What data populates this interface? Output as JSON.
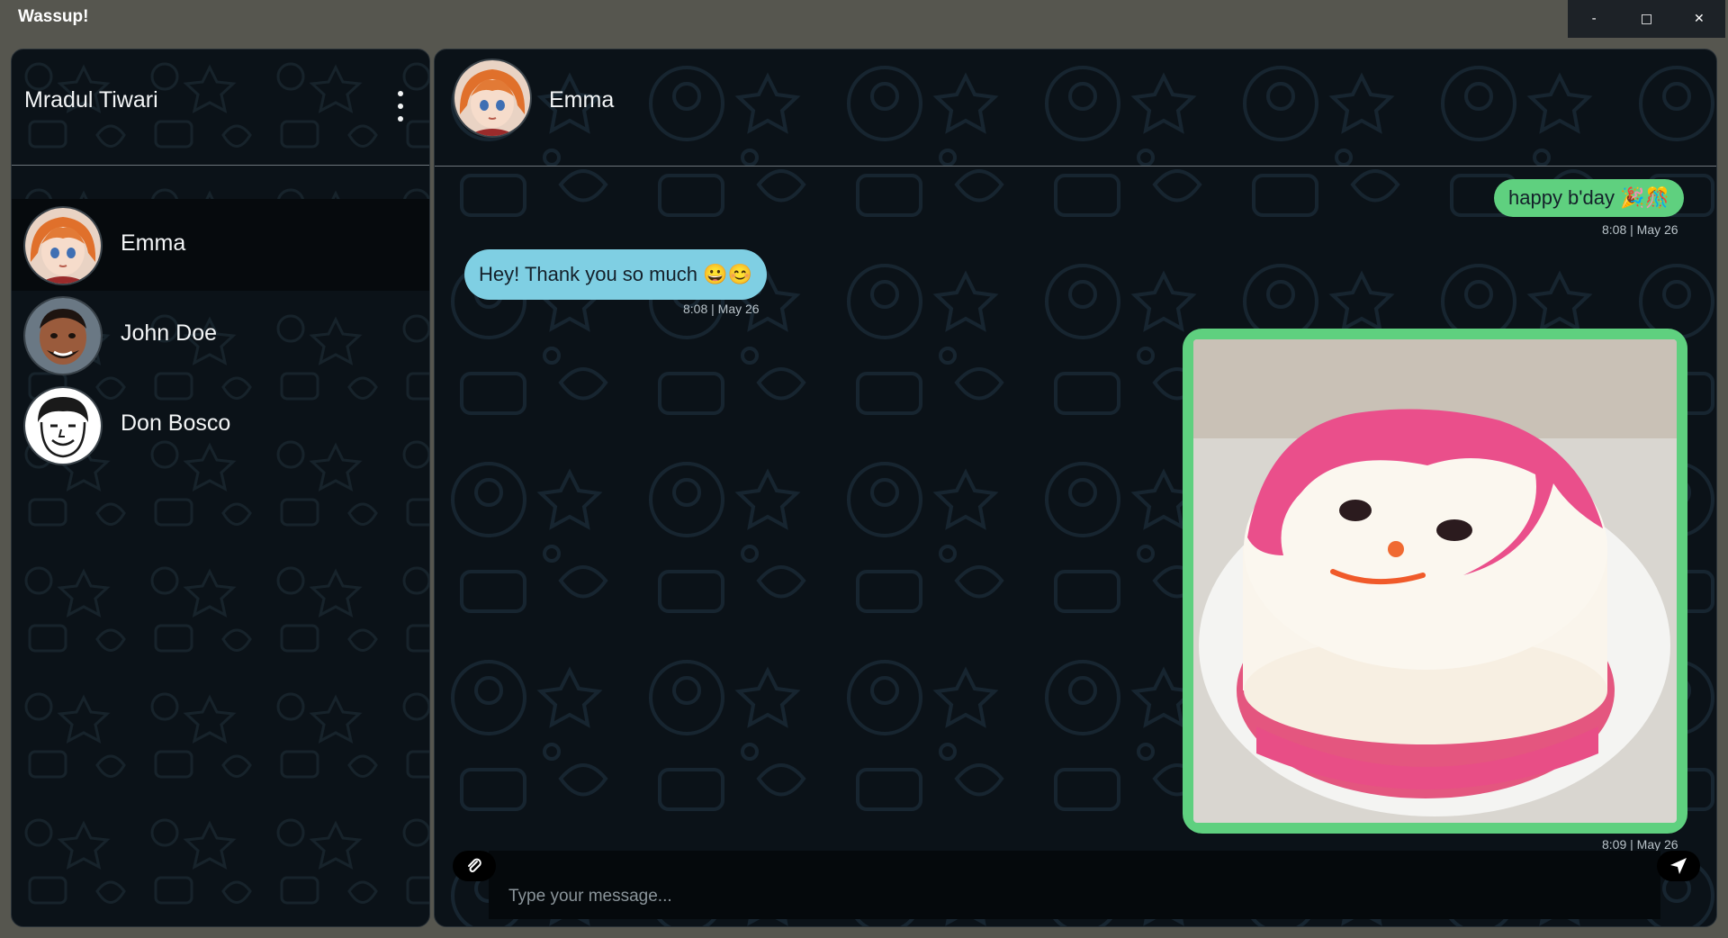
{
  "window": {
    "title": "Wassup!",
    "controls": {
      "minimize": "-",
      "maximize": "□",
      "close": "✕"
    }
  },
  "sidebar": {
    "user_name": "Mradul Tiwari",
    "menu_icon": "kebab-menu-icon",
    "contacts": [
      {
        "name": "Emma",
        "active": true
      },
      {
        "name": "John Doe",
        "active": false
      },
      {
        "name": "Don Bosco",
        "active": false
      }
    ]
  },
  "chat": {
    "contact_name": "Emma",
    "messages": [
      {
        "direction": "sent",
        "type": "text",
        "text": "happy b'day 🎉🎊",
        "time": "8:08 | May 26"
      },
      {
        "direction": "received",
        "type": "text",
        "text": "Hey! Thank you so much 😀😊",
        "time": "8:08 | May 26"
      },
      {
        "direction": "sent",
        "type": "image",
        "image": "smiley-face-cake",
        "time": "8:09 | May 26"
      }
    ],
    "composer": {
      "placeholder": "Type your message...",
      "value": "",
      "attach_icon": "paperclip-icon",
      "send_icon": "send-icon"
    }
  },
  "colors": {
    "window_frame": "#56564f",
    "panel_bg": "#0b1218",
    "sent_bubble": "#5fd07f",
    "received_bubble": "#7fcfe3",
    "active_contact": "#060a0d"
  }
}
